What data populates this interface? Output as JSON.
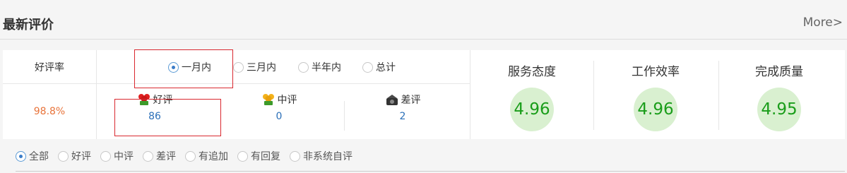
{
  "header": {
    "title": "最新评价",
    "more": "More>"
  },
  "rate": {
    "label": "好评率",
    "value": "98.8%"
  },
  "period": {
    "options": [
      "一月内",
      "三月内",
      "半年内",
      "总计"
    ],
    "selected": "一月内"
  },
  "evaluations": [
    {
      "label": "好评",
      "count": "86",
      "icon": "red-flower-icon"
    },
    {
      "label": "中评",
      "count": "0",
      "icon": "yellow-flower-icon"
    },
    {
      "label": "差评",
      "count": "2",
      "icon": "dark-camera-icon"
    }
  ],
  "scores": [
    {
      "label": "服务态度",
      "value": "4.96"
    },
    {
      "label": "工作效率",
      "value": "4.96"
    },
    {
      "label": "完成质量",
      "value": "4.95"
    }
  ],
  "filters": {
    "options": [
      "全部",
      "好评",
      "中评",
      "差评",
      "有追加",
      "有回复",
      "非系统自评"
    ],
    "selected": "全部"
  },
  "colors": {
    "rate_value": "#e8743b",
    "count": "#2a6fb8",
    "score_text": "#1a9d1a",
    "score_bg": "#d9f0d0",
    "highlight_box": "#d9282f"
  }
}
